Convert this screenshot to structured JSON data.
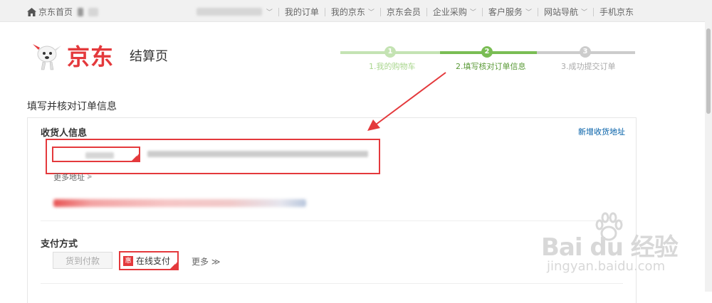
{
  "topnav": {
    "home_label": "京东首页",
    "items": [
      {
        "label": "我的订单",
        "has_chevron": false
      },
      {
        "label": "我的京东",
        "has_chevron": true
      },
      {
        "label": "京东会员",
        "has_chevron": false
      },
      {
        "label": "企业采购",
        "has_chevron": true
      },
      {
        "label": "客户服务",
        "has_chevron": true
      },
      {
        "label": "网站导航",
        "has_chevron": true
      },
      {
        "label": "手机京东",
        "has_chevron": false
      }
    ]
  },
  "header": {
    "logo_text": "京东",
    "page_title": "结算页"
  },
  "steps": [
    {
      "number": "1",
      "label": "1.我的购物车"
    },
    {
      "number": "2",
      "label": "2.填写核对订单信息"
    },
    {
      "number": "3",
      "label": "3.成功提交订单"
    }
  ],
  "section_title": "填写并核对订单信息",
  "consignee": {
    "title": "收货人信息",
    "add_address": "新增收货地址",
    "more_address": "更多地址",
    "more_chevron": "≽"
  },
  "payment": {
    "title": "支付方式",
    "cod_label": "货到付款",
    "online_badge": "惠",
    "online_label": "在线支付",
    "more_label": "更多 ≫"
  },
  "watermark": {
    "main": "Bai du 经验",
    "sub": "jingyan.baidu.com"
  },
  "colors": {
    "brand_red": "#e4393c",
    "step_done": "#c4e3b3",
    "step_active": "#7abd54",
    "step_pending": "#cccccc",
    "link_blue": "#005ea7"
  }
}
